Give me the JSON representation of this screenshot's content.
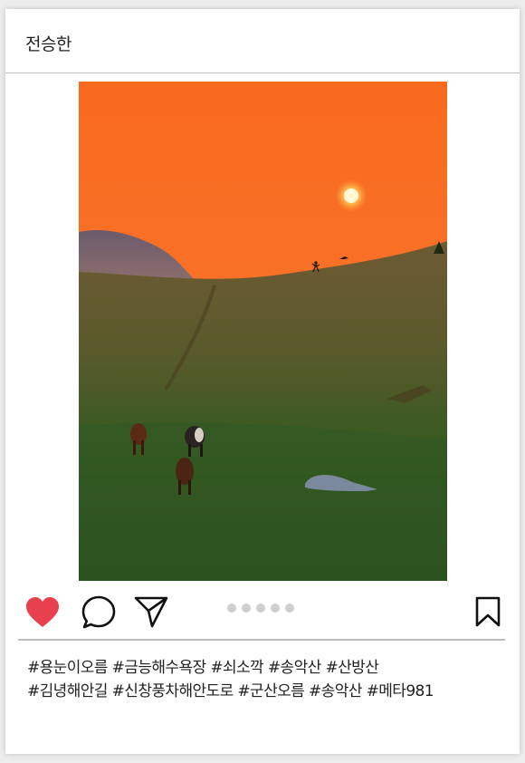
{
  "post": {
    "username": "전승한",
    "photo_alt": "",
    "carousel": {
      "count": 5,
      "active_index": 0
    },
    "liked": true,
    "caption_lines": [
      "#용눈이오름 #금능해수욕장 #쇠소깍 #송악산 #산방산",
      "#김녕해안길 #신창풍차해안도로 #군산오름 #송악산 #메타981"
    ]
  },
  "icons": {
    "like": "heart-icon",
    "comment": "comment-icon",
    "share": "send-icon",
    "save": "bookmark-icon"
  },
  "colors": {
    "like_red": "#e8404f",
    "divider": "#bdbdbd",
    "dot": "#cfcfcf"
  }
}
